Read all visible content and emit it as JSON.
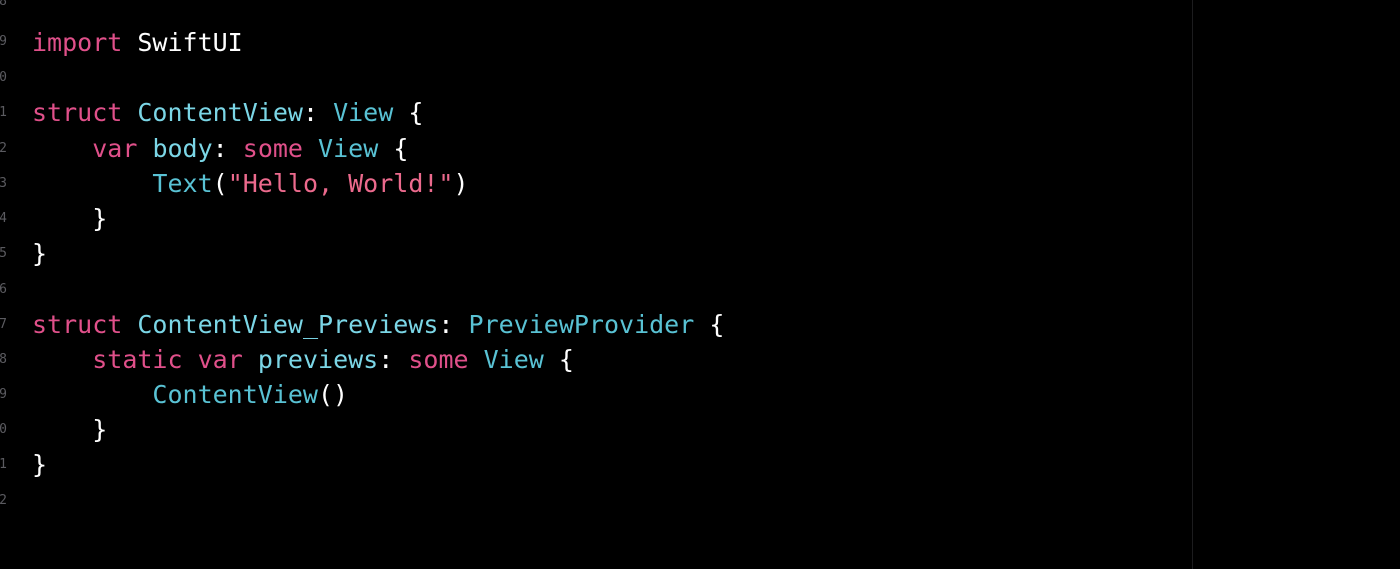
{
  "colors": {
    "background": "#000000",
    "plain": "#ffffff",
    "keyword": "#e0508a",
    "type": "#59c2d4",
    "declaration": "#7bd6e6",
    "string": "#ec6a8d",
    "gutter": "#5b5b60",
    "ruler": "#1c1c1e"
  },
  "gutter": {
    "numbers": [
      "8",
      "9",
      "0",
      "1",
      "2",
      "3",
      "4",
      "5",
      "6",
      "7",
      "8",
      "9",
      "0",
      "1",
      "2"
    ]
  },
  "code": {
    "lines": [
      [
        {
          "text": "import",
          "kind": "keyword"
        },
        {
          "text": " SwiftUI",
          "kind": "plain"
        }
      ],
      [],
      [
        {
          "text": "struct",
          "kind": "keyword"
        },
        {
          "text": " ",
          "kind": "plain"
        },
        {
          "text": "ContentView",
          "kind": "declaration"
        },
        {
          "text": ": ",
          "kind": "plain"
        },
        {
          "text": "View",
          "kind": "type"
        },
        {
          "text": " {",
          "kind": "plain"
        }
      ],
      [
        {
          "text": "    ",
          "kind": "plain"
        },
        {
          "text": "var",
          "kind": "keyword"
        },
        {
          "text": " ",
          "kind": "plain"
        },
        {
          "text": "body",
          "kind": "declaration"
        },
        {
          "text": ": ",
          "kind": "plain"
        },
        {
          "text": "some",
          "kind": "keyword"
        },
        {
          "text": " ",
          "kind": "plain"
        },
        {
          "text": "View",
          "kind": "type"
        },
        {
          "text": " {",
          "kind": "plain"
        }
      ],
      [
        {
          "text": "        ",
          "kind": "plain"
        },
        {
          "text": "Text",
          "kind": "type"
        },
        {
          "text": "(",
          "kind": "plain"
        },
        {
          "text": "\"Hello, World!\"",
          "kind": "string"
        },
        {
          "text": ")",
          "kind": "plain"
        }
      ],
      [
        {
          "text": "    }",
          "kind": "plain"
        }
      ],
      [
        {
          "text": "}",
          "kind": "plain"
        }
      ],
      [],
      [
        {
          "text": "struct",
          "kind": "keyword"
        },
        {
          "text": " ",
          "kind": "plain"
        },
        {
          "text": "ContentView_Previews",
          "kind": "declaration"
        },
        {
          "text": ": ",
          "kind": "plain"
        },
        {
          "text": "PreviewProvider",
          "kind": "type"
        },
        {
          "text": " {",
          "kind": "plain"
        }
      ],
      [
        {
          "text": "    ",
          "kind": "plain"
        },
        {
          "text": "static",
          "kind": "keyword"
        },
        {
          "text": " ",
          "kind": "plain"
        },
        {
          "text": "var",
          "kind": "keyword"
        },
        {
          "text": " ",
          "kind": "plain"
        },
        {
          "text": "previews",
          "kind": "declaration"
        },
        {
          "text": ": ",
          "kind": "plain"
        },
        {
          "text": "some",
          "kind": "keyword"
        },
        {
          "text": " ",
          "kind": "plain"
        },
        {
          "text": "View",
          "kind": "type"
        },
        {
          "text": " {",
          "kind": "plain"
        }
      ],
      [
        {
          "text": "        ",
          "kind": "plain"
        },
        {
          "text": "ContentView",
          "kind": "type"
        },
        {
          "text": "()",
          "kind": "plain"
        }
      ],
      [
        {
          "text": "    }",
          "kind": "plain"
        }
      ],
      [
        {
          "text": "}",
          "kind": "plain"
        }
      ]
    ]
  }
}
